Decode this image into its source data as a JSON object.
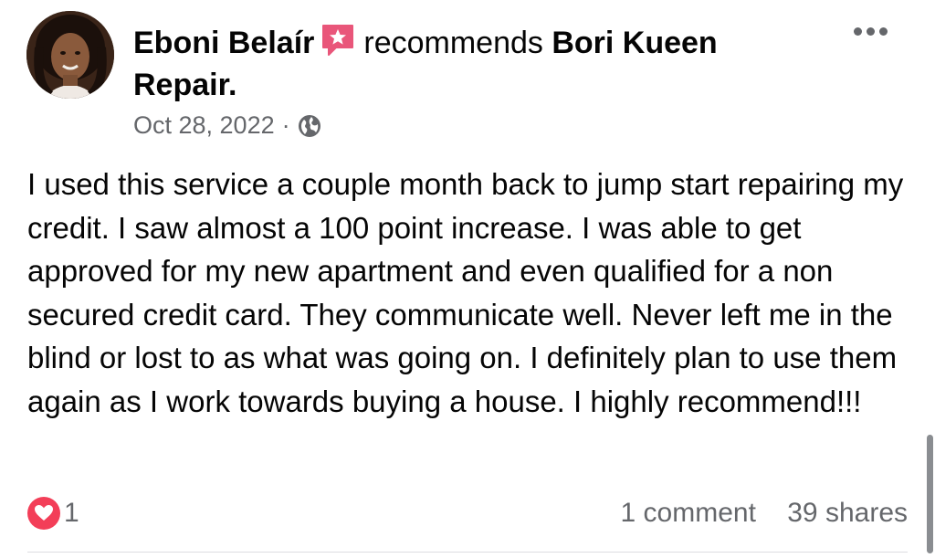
{
  "post": {
    "author": "Eboni Belaír",
    "recommendation_text": "recommends",
    "business": "Bori Kueen Repair.",
    "date": "Oct 28, 2022",
    "separator": "·",
    "privacy_icon": "globe-icon",
    "recommend_icon": "recommend-star-icon",
    "more_icon": "more-options-icon",
    "body": "I used this service a couple month back to jump start repairing my credit. I saw almost a 100 point increase. I was able to get approved for my new apartment and even qualified for a non secured credit card. They communicate well. Never left me in the blind or lost to as what was going on. I definitely plan to use them again as I work towards buying a house. I highly recommend!!!",
    "reaction_icon": "heart-reaction-icon",
    "reaction_count": "1",
    "comments": "1 comment",
    "shares": "39 shares"
  },
  "colors": {
    "text": "#050505",
    "secondary": "#65676b",
    "heart": "#f33e58",
    "recommend": "#e9567a"
  }
}
